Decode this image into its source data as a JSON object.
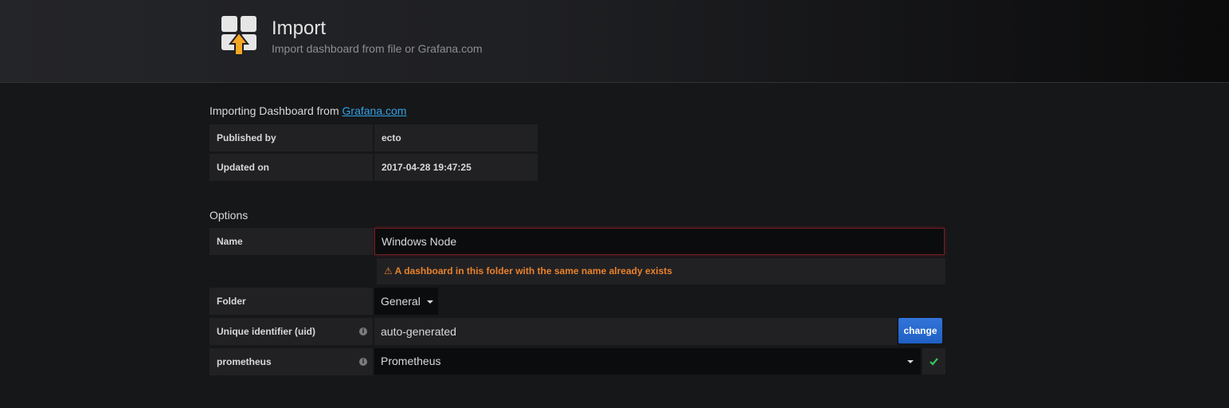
{
  "header": {
    "title": "Import",
    "subtitle": "Import dashboard from file or Grafana.com",
    "logo_icon": "import-dashboard-icon"
  },
  "source": {
    "prefix": "Importing Dashboard from ",
    "link": "Grafana.com"
  },
  "info_table": [
    {
      "label": "Published by",
      "value": "ecto"
    },
    {
      "label": "Updated on",
      "value": "2017-04-28 19:47:25"
    }
  ],
  "options": {
    "title": "Options",
    "name": {
      "label": "Name",
      "value": "Windows Node"
    },
    "warning": "A dashboard in this folder with the same name already exists",
    "folder": {
      "label": "Folder",
      "value": "General"
    },
    "uid": {
      "label": "Unique identifier (uid)",
      "value": "auto-generated",
      "button": "change"
    },
    "datasource": {
      "label": "prometheus",
      "value": "Prometheus"
    }
  },
  "colors": {
    "link": "#33a2e5",
    "warning": "#e9822b",
    "primary_button": "#3274d9",
    "success": "#34c759",
    "error_border": "#6e1f25"
  }
}
